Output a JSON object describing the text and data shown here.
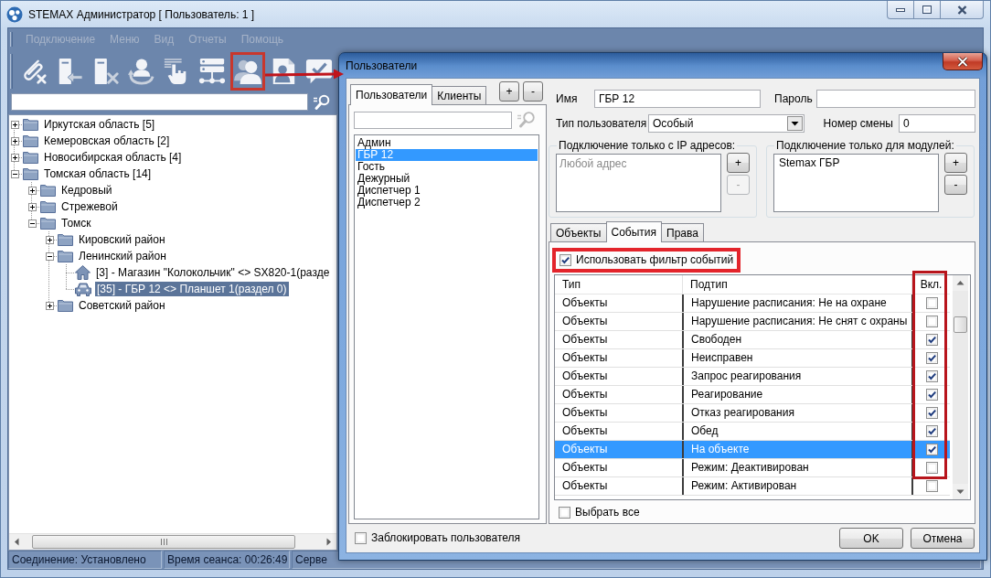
{
  "window": {
    "title": "STEMAX Администратор [ Пользователь: 1 ]"
  },
  "menu": [
    {
      "label": "Подключение",
      "disabled": true
    },
    {
      "label": "Меню",
      "disabled": true
    },
    {
      "label": "Вид",
      "disabled": true
    },
    {
      "label": "Отчеты",
      "disabled": true
    },
    {
      "label": "Помощь",
      "disabled": true
    }
  ],
  "toolbar": [
    {
      "kind": "paperclip",
      "highlighted": false
    },
    {
      "kind": "signin",
      "highlighted": false
    },
    {
      "kind": "signout",
      "highlighted": false
    },
    {
      "kind": "rotate",
      "highlighted": false
    },
    {
      "kind": "touch",
      "highlighted": false
    },
    {
      "kind": "network",
      "highlighted": false
    },
    {
      "kind": "users",
      "highlighted": true
    },
    {
      "kind": "card",
      "highlighted": false
    },
    {
      "kind": "message",
      "highlighted": false
    }
  ],
  "tree": [
    {
      "label": "Иркутская область [5]",
      "kind": "folder",
      "expanded": false,
      "selected": false
    },
    {
      "label": "Кемеровская область [2]",
      "kind": "folder",
      "expanded": false,
      "selected": false
    },
    {
      "label": "Новосибирская область [4]",
      "kind": "folder",
      "expanded": false,
      "selected": false
    },
    {
      "label": "Томская область [14]",
      "kind": "folder",
      "expanded": true,
      "selected": false,
      "children": [
        {
          "label": "Кедровый",
          "kind": "folder",
          "expanded": false,
          "selected": false
        },
        {
          "label": "Стрежевой",
          "kind": "folder",
          "expanded": false,
          "selected": false
        },
        {
          "label": "Томск",
          "kind": "folder",
          "expanded": true,
          "selected": false,
          "children": [
            {
              "label": "Кировский район",
              "kind": "folder",
              "expanded": false,
              "selected": false
            },
            {
              "label": "Ленинский район",
              "kind": "folder",
              "expanded": true,
              "selected": false,
              "children": [
                {
                  "label": "[3] - Магазин \"Колокольчик\" <> SX820-1(разде",
                  "kind": "object",
                  "selected": false
                },
                {
                  "label": "[35] - ГБР 12 <> Планшет 1(раздел 0)",
                  "kind": "crew",
                  "selected": true
                }
              ]
            },
            {
              "label": "Советский район",
              "kind": "folder",
              "expanded": false,
              "selected": false
            }
          ]
        }
      ]
    }
  ],
  "status_bar": [
    "Соединение: Установлено",
    "Время сеанса: 00:26:49",
    "Серве"
  ],
  "dialog": {
    "title": "Пользователи",
    "tabs": [
      {
        "label": "Пользователи",
        "selected": true
      },
      {
        "label": "Клиенты",
        "selected": false
      }
    ],
    "list_buttons": [
      {
        "label": "+",
        "disabled": false
      },
      {
        "label": "-",
        "disabled": false
      }
    ],
    "users": [
      {
        "name": "Админ",
        "selected": false
      },
      {
        "name": "ГБР 12",
        "selected": true
      },
      {
        "name": "Гость",
        "selected": false
      },
      {
        "name": "Дежурный",
        "selected": false
      },
      {
        "name": "Диспетчер 1",
        "selected": false
      },
      {
        "name": "Диспетчер 2",
        "selected": false
      }
    ],
    "block_user": {
      "label": "Заблокировать пользователя",
      "checked": false
    },
    "form": {
      "name": {
        "label": "Имя",
        "value": "ГБР 12"
      },
      "password": {
        "label": "Пароль"
      },
      "user_type": {
        "label": "Тип пользователя",
        "value": "Особый"
      },
      "shift": {
        "label": "Номер смены",
        "value": "0"
      }
    },
    "ip_filter": {
      "title": "Подключение только с IP адресов:",
      "placeholder": "Любой адрес",
      "buttons": [
        {
          "label": "+",
          "disabled": false
        },
        {
          "label": "-",
          "disabled": true
        }
      ]
    },
    "module_filter": {
      "title": "Подключение только для модулей:",
      "items": [
        {
          "label": "Stemax ГБР",
          "selected": false
        }
      ],
      "buttons": [
        {
          "label": "+",
          "disabled": false
        },
        {
          "label": "-",
          "disabled": false
        }
      ]
    },
    "detail_tabs": [
      {
        "label": "Объекты",
        "selected": false
      },
      {
        "label": "События",
        "selected": true
      },
      {
        "label": "Права",
        "selected": false
      }
    ],
    "event_filter": {
      "label": "Использовать фильтр событий",
      "checked": true,
      "highlighted": true
    },
    "table": {
      "columns": [
        {
          "label": "Тип",
          "highlighted": false
        },
        {
          "label": "Подтип",
          "highlighted": false
        },
        {
          "label": "Вкл.",
          "highlighted": true
        }
      ],
      "rows": [
        {
          "type": "Объекты",
          "subtype": "Нарушение расписания: Не на охране",
          "enabled": false,
          "selected": false
        },
        {
          "type": "Объекты",
          "subtype": "Нарушение расписания: Не снят с охраны",
          "enabled": false,
          "selected": false
        },
        {
          "type": "Объекты",
          "subtype": "Свободен",
          "enabled": true,
          "selected": false
        },
        {
          "type": "Объекты",
          "subtype": "Неисправен",
          "enabled": true,
          "selected": false
        },
        {
          "type": "Объекты",
          "subtype": "Запрос реагирования",
          "enabled": true,
          "selected": false
        },
        {
          "type": "Объекты",
          "subtype": "Реагирование",
          "enabled": true,
          "selected": false
        },
        {
          "type": "Объекты",
          "subtype": "Отказ реагирования",
          "enabled": true,
          "selected": false
        },
        {
          "type": "Объекты",
          "subtype": "Обед",
          "enabled": true,
          "selected": false
        },
        {
          "type": "Объекты",
          "subtype": "На объекте",
          "enabled": true,
          "selected": true
        },
        {
          "type": "Объекты",
          "subtype": "Режим: Деактивирован",
          "enabled": false,
          "selected": false
        },
        {
          "type": "Объекты",
          "subtype": "Режим: Активирован",
          "enabled": false,
          "selected": false
        }
      ]
    },
    "select_all": {
      "label": "Выбрать все",
      "checked": false
    },
    "buttons": [
      "OK",
      "Отмена"
    ]
  }
}
